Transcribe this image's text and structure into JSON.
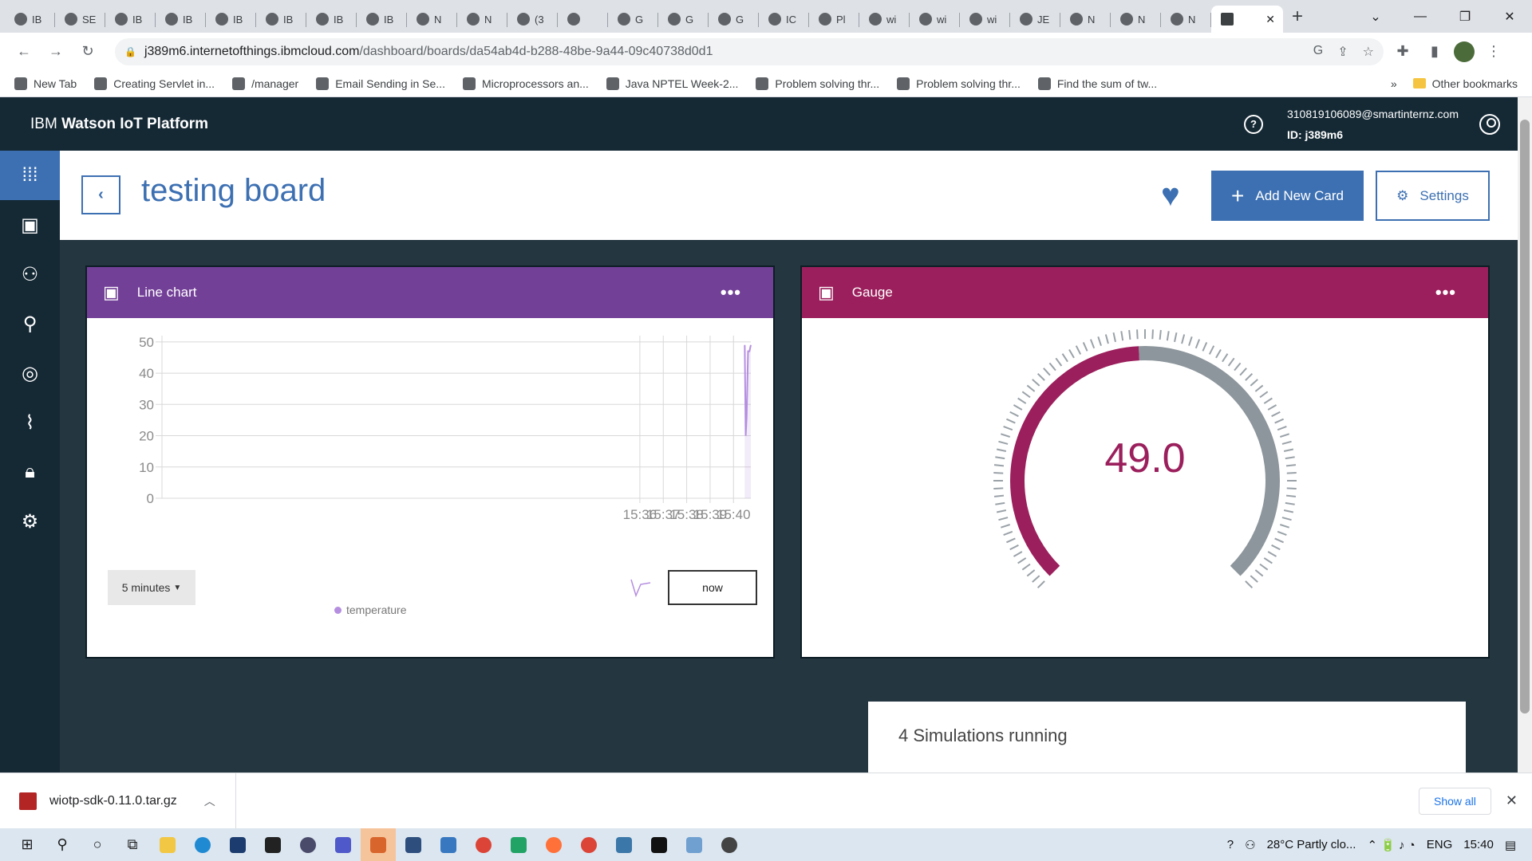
{
  "browser": {
    "tabs": [
      {
        "label": "IB"
      },
      {
        "label": "SE"
      },
      {
        "label": "IB"
      },
      {
        "label": "IB"
      },
      {
        "label": "IB"
      },
      {
        "label": "IB"
      },
      {
        "label": "IB"
      },
      {
        "label": "IB"
      },
      {
        "label": "N"
      },
      {
        "label": "N"
      },
      {
        "label": "(3"
      },
      {
        "label": ""
      },
      {
        "label": "G"
      },
      {
        "label": "G"
      },
      {
        "label": "G"
      },
      {
        "label": "IC"
      },
      {
        "label": "Pl"
      },
      {
        "label": "wi"
      },
      {
        "label": "wi"
      },
      {
        "label": "wi"
      },
      {
        "label": "JE"
      },
      {
        "label": "N"
      },
      {
        "label": "N"
      },
      {
        "label": "N"
      }
    ],
    "url_host": "j389m6.internetofthings.ibmcloud.com",
    "url_path": "/dashboard/boards/da54ab4d-b288-48be-9a44-09c40738d0d1",
    "bookmarks": [
      "New Tab",
      "Creating Servlet in...",
      "/manager",
      "Email Sending in Se...",
      "Microprocessors an...",
      "Java NPTEL Week-2...",
      "Problem solving thr...",
      "Problem solving thr...",
      "Find the sum of tw..."
    ],
    "more_bookmarks": "»",
    "other_bookmarks": "Other bookmarks"
  },
  "app": {
    "title_prefix": "IBM ",
    "title_bold": "Watson IoT Platform",
    "help": "?",
    "user_email": "310819106089@smartinternz.com",
    "user_id": "ID: j389m6"
  },
  "board": {
    "back": "‹",
    "title": "testing board",
    "add_card": "Add New Card",
    "add_plus": "+",
    "settings": "Settings"
  },
  "line_card": {
    "title": "Line chart",
    "menu": "•••",
    "range": "5 minutes",
    "now": "now",
    "legend": "temperature"
  },
  "gauge_card": {
    "title": "Gauge",
    "menu": "•••",
    "value": "49.0",
    "fraction": 0.49
  },
  "sim": {
    "text": "4 Simulations running"
  },
  "download": {
    "file": "wiotp-sdk-0.11.0.tar.gz",
    "show_all": "Show all"
  },
  "taskbar": {
    "weather": "28°C  Partly clo...",
    "lang": "ENG",
    "time": "15:40"
  },
  "colors": {
    "accent": "#3d70b2",
    "line_header": "#734098",
    "gauge_header": "#9b1f5c",
    "gauge_track": "#8d969c",
    "series": "#b58ee0"
  },
  "chart_data": {
    "type": "line",
    "x_ticks": [
      "15:36",
      "15:37",
      "15:38",
      "15:39",
      "15:40"
    ],
    "y_ticks": [
      0,
      10,
      20,
      30,
      40,
      50
    ],
    "ylim": [
      0,
      52
    ],
    "xlim_minutes": [
      15.59,
      40.74
    ],
    "series": [
      {
        "name": "temperature",
        "points": [
          [
            40.48,
            49
          ],
          [
            40.52,
            20
          ],
          [
            40.56,
            26
          ],
          [
            40.62,
            47
          ],
          [
            40.68,
            47
          ],
          [
            40.74,
            49
          ]
        ]
      }
    ],
    "legend": "bottom",
    "grid": true
  }
}
